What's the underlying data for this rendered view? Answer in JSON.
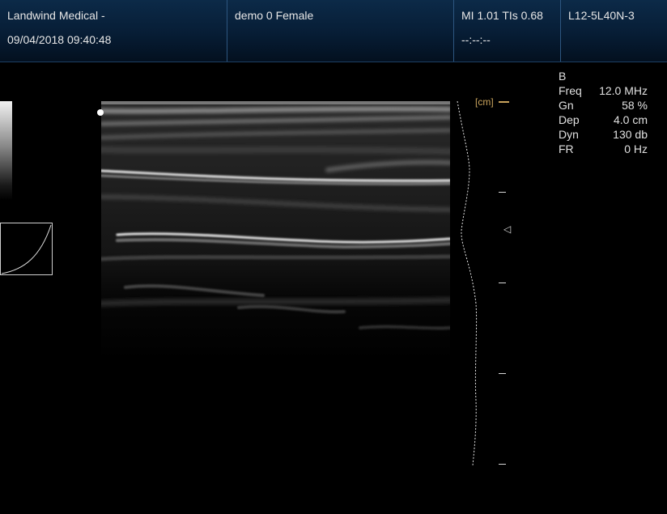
{
  "header": {
    "institution": "Landwind Medical -",
    "datetime": "09/04/2018 09:40:48",
    "patient": "demo 0 Female",
    "mi_tis": "MI 1.01 TIs 0.68",
    "timer": "--:--:--",
    "probe": "L12-5L40N-3"
  },
  "params": {
    "mode": "B",
    "rows": [
      {
        "name": "Freq",
        "value": "12.0 MHz"
      },
      {
        "name": "Gn",
        "value": "58 %"
      },
      {
        "name": "Dep",
        "value": "4.0 cm"
      },
      {
        "name": "Dyn",
        "value": "130 db"
      },
      {
        "name": "FR",
        "value": "0 Hz"
      }
    ]
  },
  "scale": {
    "unit_label": "[cm]"
  },
  "colors": {
    "header_bg": "#071d35",
    "header_divider": "#2d5680",
    "scale_accent": "#c9a35c"
  }
}
